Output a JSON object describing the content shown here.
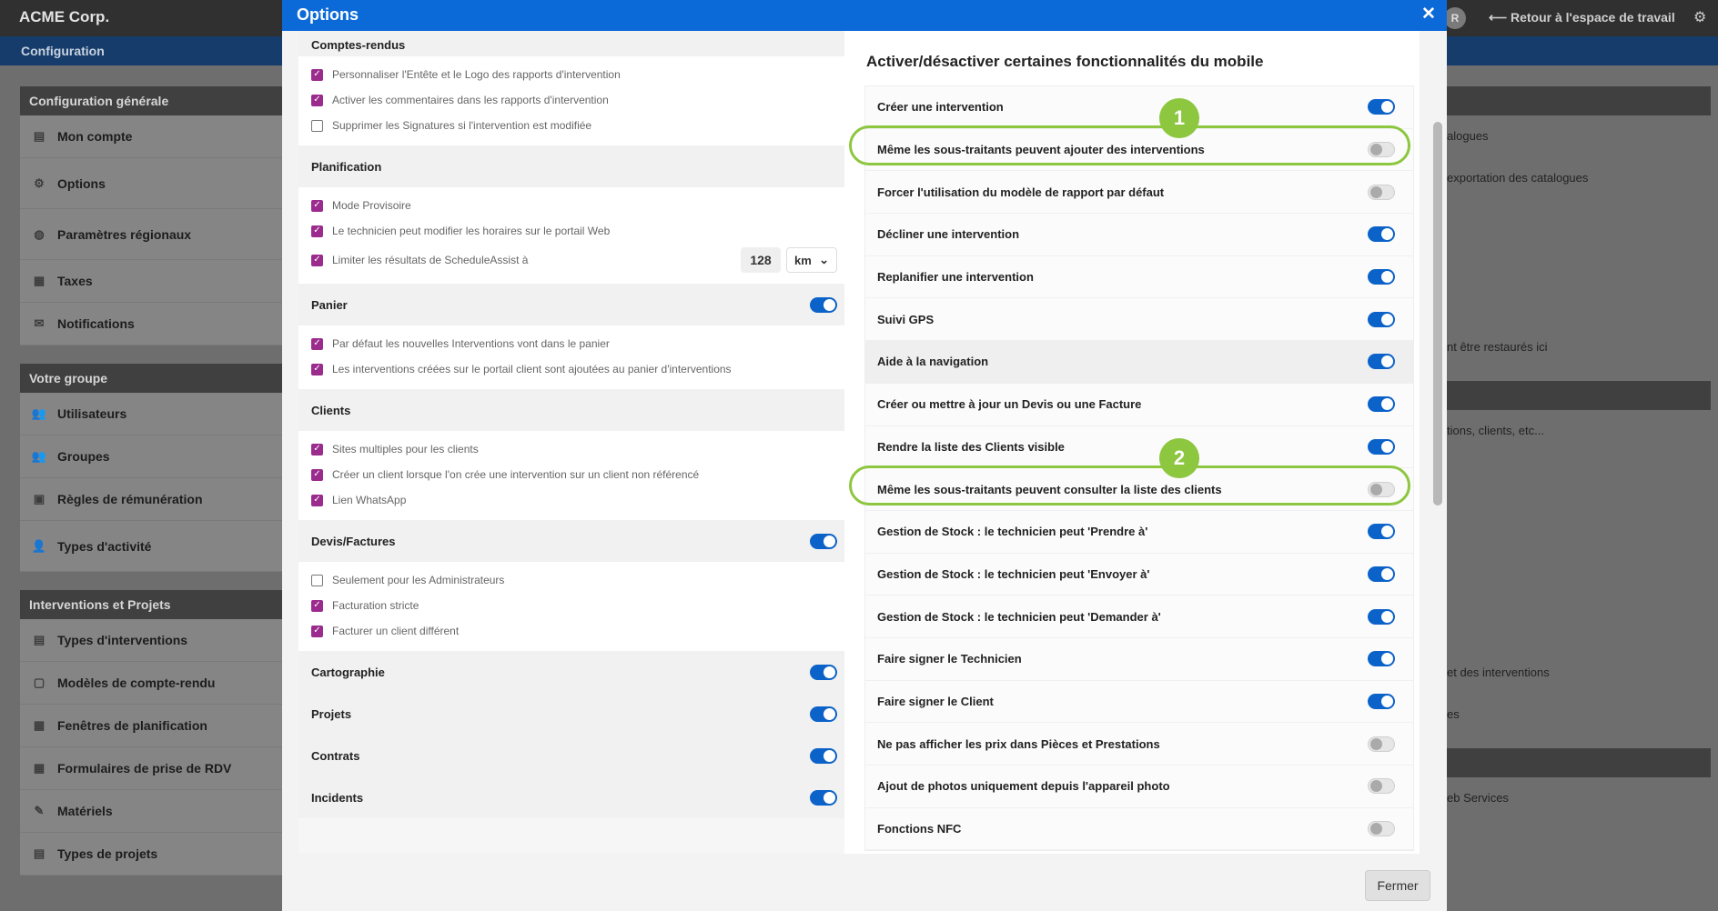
{
  "app": {
    "brand": "ACME Corp.",
    "config": "Configuration",
    "back": "⟵ Retour à l'espace de travail",
    "avatar": "R"
  },
  "sidebar": {
    "groups": [
      {
        "title": "Configuration générale",
        "items": [
          "Mon compte",
          "Options",
          "Paramètres régionaux",
          "Taxes",
          "Notifications"
        ]
      },
      {
        "title": "Votre groupe",
        "items": [
          "Utilisateurs",
          "Groupes",
          "Règles de rémunération",
          "Types d'activité"
        ]
      },
      {
        "title": "Interventions et Projets",
        "items": [
          "Types d'interventions",
          "Modèles de compte-rendu",
          "Fenêtres de planification",
          "Formulaires de prise de RDV",
          "Matériels",
          "Types de projets"
        ]
      }
    ]
  },
  "background_right": [
    "alogues",
    "exportation des catalogues",
    "nt être restaurés ici",
    "tions, clients, etc...",
    "et des interventions",
    "es",
    "eb Services"
  ],
  "modal": {
    "title": "Options",
    "close": "✕",
    "footer_button": "Fermer"
  },
  "left": {
    "comptes_rendus": {
      "title": "Comptes-rendus",
      "items": [
        "Personnaliser l'Entête et le Logo des rapports d'intervention",
        "Activer les commentaires dans les rapports d'intervention",
        "Supprimer les Signatures si l'intervention est modifiée"
      ]
    },
    "planification": {
      "title": "Planification",
      "items": [
        "Mode Provisoire",
        "Le technicien peut modifier les horaires sur le portail Web",
        "Limiter les résultats de ScheduleAssist à"
      ],
      "limit_value": "128",
      "limit_unit": "km"
    },
    "panier": {
      "title": "Panier",
      "items": [
        "Par défaut les nouvelles Interventions vont dans le panier",
        "Les interventions créées sur le portail client sont ajoutées au panier d'interventions"
      ]
    },
    "clients": {
      "title": "Clients",
      "items": [
        "Sites multiples pour les clients",
        "Créer un client lorsque l'on crée une intervention sur un client non référencé",
        "Lien WhatsApp"
      ]
    },
    "devis": {
      "title": "Devis/Factures",
      "items": [
        "Seulement pour les Administrateurs",
        "Facturation stricte",
        "Facturer un client différent"
      ]
    },
    "sections": [
      "Cartographie",
      "Projets",
      "Contrats",
      "Incidents"
    ]
  },
  "right": {
    "title": "Activer/désactiver certaines fonctionnalités du mobile",
    "rows": [
      "Créer une intervention",
      "Même les sous-traitants peuvent ajouter des interventions",
      "Forcer l'utilisation du modèle de rapport par défaut",
      "Décliner une intervention",
      "Replanifier une intervention",
      "Suivi GPS",
      "Aide à la navigation",
      "Créer ou mettre à jour un Devis ou une Facture",
      "Rendre la liste des Clients visible",
      "Même les sous-traitants peuvent consulter la liste des clients",
      "Gestion de Stock : le technicien peut 'Prendre à'",
      "Gestion de Stock : le technicien peut 'Envoyer à'",
      "Gestion de Stock : le technicien peut 'Demander à'",
      "Faire signer le Technicien",
      "Faire signer le Client",
      "Ne pas afficher les prix dans Pièces et Prestations",
      "Ajout de photos uniquement depuis l'appareil photo",
      "Fonctions NFC"
    ]
  },
  "callouts": [
    "1",
    "2"
  ]
}
